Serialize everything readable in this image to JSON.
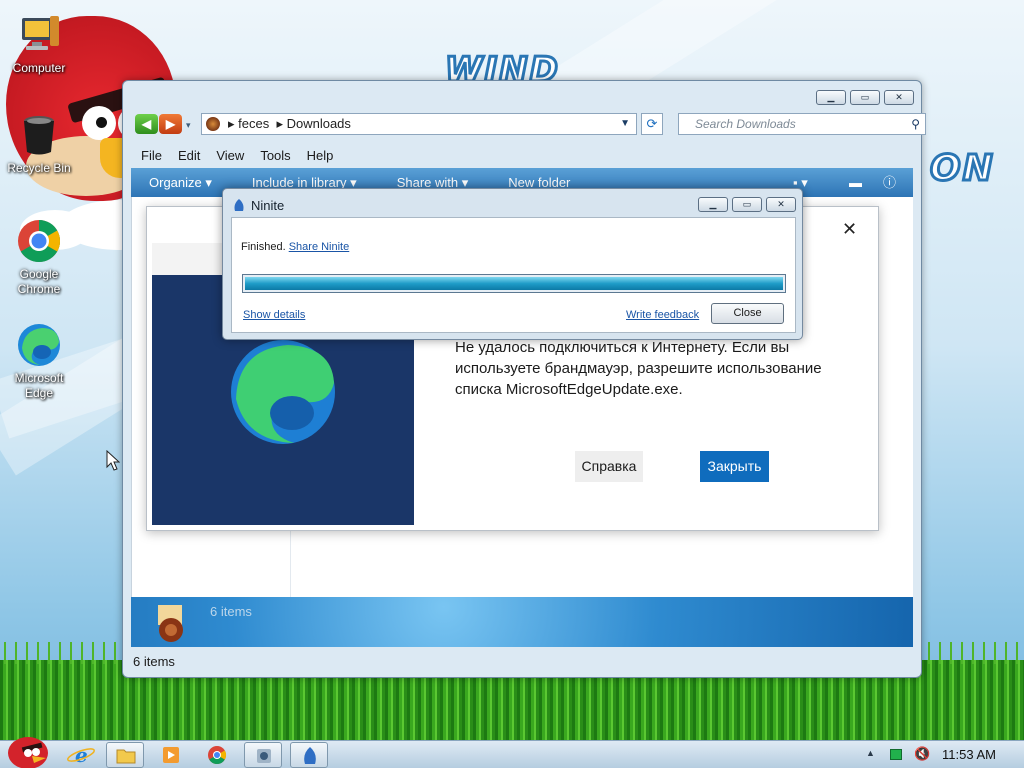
{
  "desktop": {
    "icons": [
      {
        "label": "Computer"
      },
      {
        "label": "Recycle Bin"
      },
      {
        "label": "Google Chrome"
      },
      {
        "label": "Microsoft Edge"
      }
    ]
  },
  "explorer": {
    "path": [
      "feces",
      "Downloads"
    ],
    "search_placeholder": "Search Downloads",
    "menu": [
      "File",
      "Edit",
      "View",
      "Tools",
      "Help"
    ],
    "commands": [
      "Organize",
      "Include in library",
      "Share with",
      "New folder"
    ],
    "details_count": "6 items",
    "status_text": "6 items"
  },
  "edge_dialog": {
    "message": "Не удалось подключиться к Интернету. Если вы используете брандмауэр, разрешите использование списка MicrosoftEdgeUpdate.exe.",
    "help_label": "Справка",
    "close_label": "Закрыть"
  },
  "ninite": {
    "title": "Ninite",
    "status": "Finished.",
    "share_link": "Share Ninite",
    "progress": 1.0,
    "details_link": "Show details",
    "feedback_link": "Write feedback",
    "close_label": "Close"
  },
  "taskbar": {
    "time": "11:53 AM"
  }
}
